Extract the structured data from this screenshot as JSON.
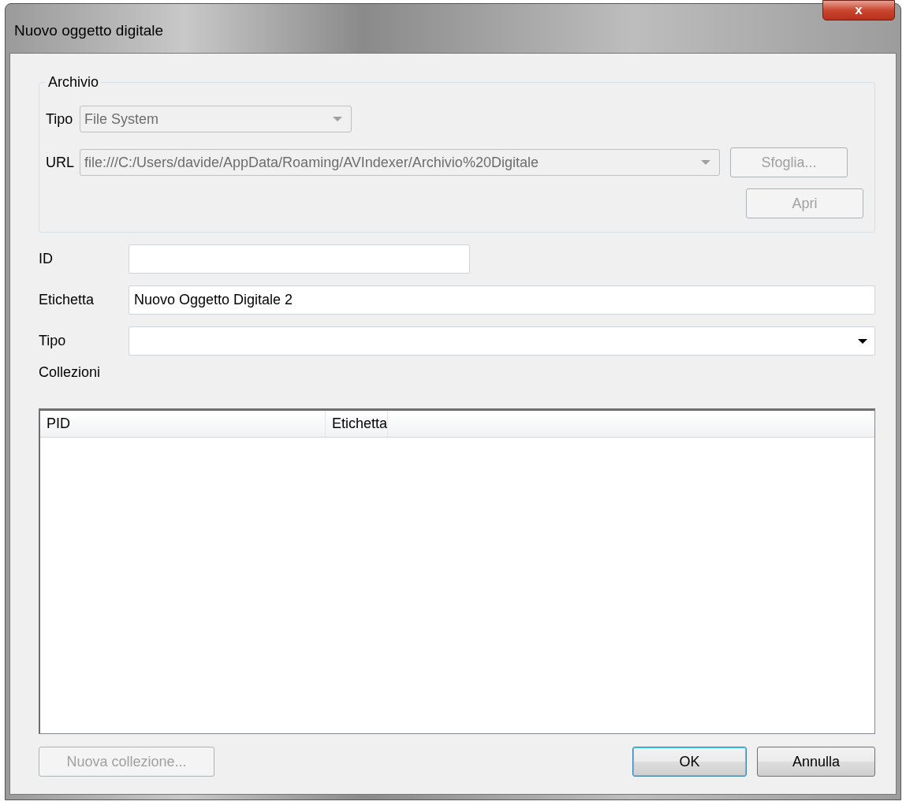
{
  "window": {
    "title": "Nuovo oggetto digitale",
    "close": "x"
  },
  "archive": {
    "legend": "Archivio",
    "type": {
      "label": "Tipo",
      "value": "File System",
      "disabled": true
    },
    "url": {
      "label": "URL",
      "value": "file:///C:/Users/davide/AppData/Roaming/AVIndexer/Archivio%20Digitale",
      "disabled": true
    },
    "buttons": [
      {
        "label": "Sfoglia...",
        "disabled": true
      },
      {
        "label": "Apri",
        "disabled": true
      }
    ]
  },
  "fields": [
    {
      "kind": "text",
      "label": "ID",
      "short": true
    },
    {
      "kind": "text",
      "label": "Etichetta",
      "value": "Nuovo Oggetto Digitale 2",
      "short": false
    },
    {
      "kind": "combo",
      "label": "Tipo",
      "short": false
    }
  ],
  "collections": {
    "label": "Collezioni",
    "columns": [
      "PID",
      "Etichetta"
    ]
  },
  "buttons": [
    {
      "label": "Nuova collezione...",
      "disabled": true,
      "default": false
    },
    {
      "label": "OK",
      "disabled": false,
      "default": true
    },
    {
      "label": "Annulla",
      "disabled": false,
      "default": false
    }
  ]
}
